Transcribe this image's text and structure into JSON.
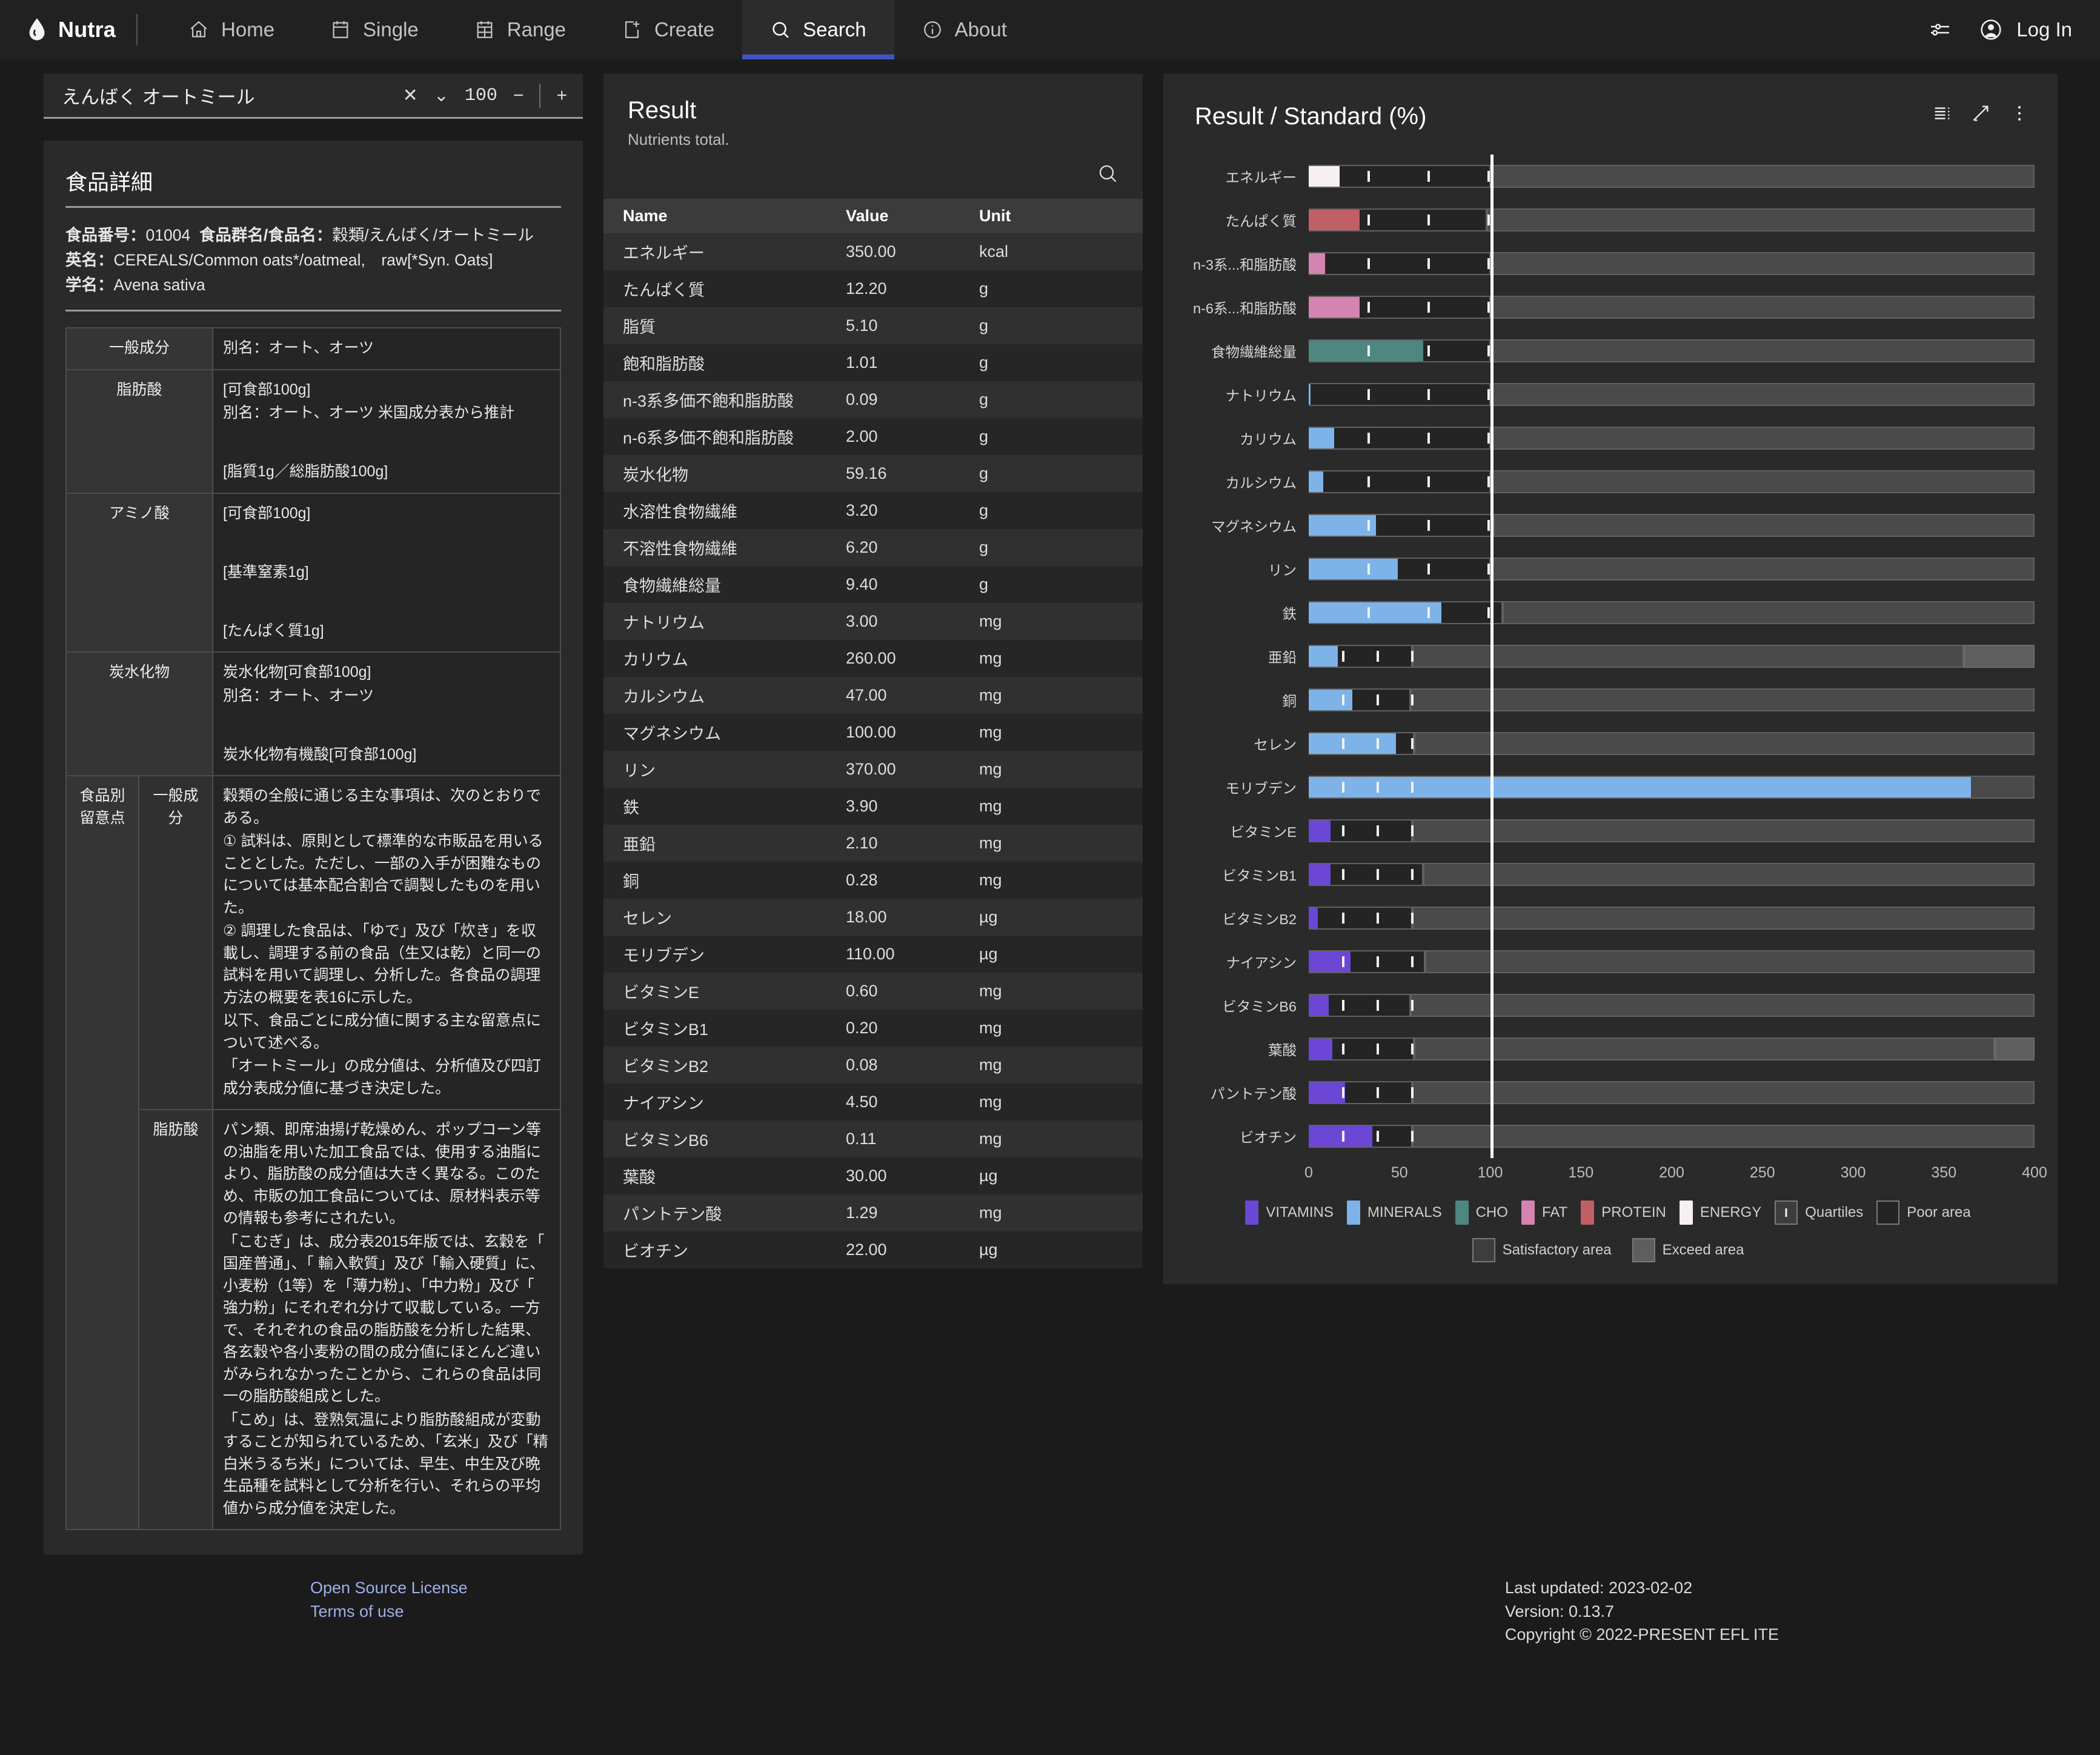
{
  "nav": {
    "brand": "Nutra",
    "items": [
      {
        "label": "Home",
        "icon": "home-icon",
        "active": false
      },
      {
        "label": "Single",
        "icon": "calendar-day-icon",
        "active": false
      },
      {
        "label": "Range",
        "icon": "calendar-range-icon",
        "active": false
      },
      {
        "label": "Create",
        "icon": "file-plus-icon",
        "active": false
      },
      {
        "label": "Search",
        "icon": "search-icon",
        "active": true
      },
      {
        "label": "About",
        "icon": "info-icon",
        "active": false
      }
    ],
    "settings_icon": "sliders-icon",
    "account_icon": "account-circle-icon",
    "login_label": "Log In",
    "accent": "#4055c4"
  },
  "search": {
    "query": "えんばく オートミール",
    "clear_label": "✕",
    "chevron_label": "⌄",
    "quantity": "100",
    "minus_label": "−",
    "plus_label": "+"
  },
  "detail": {
    "title": "食品詳細",
    "food_no_label": "食品番号：",
    "food_no": "01004",
    "group_label": "食品群名/食品名：",
    "group_value": "穀類/えんばく/オートミール",
    "en_label": "英名：",
    "en_value": "CEREALS/Common oats*/oatmeal,　raw[*Syn. Oats]",
    "sci_label": "学名：",
    "sci_value": "Avena sativa",
    "rows": [
      {
        "key": "一般成分",
        "key2": null,
        "lines": [
          "別名：オート、オーツ"
        ]
      },
      {
        "key": "脂肪酸",
        "key2": null,
        "lines": [
          "[可食部100g]",
          "別名：オート、オーツ 米国成分表から推計",
          "",
          "[脂質1g／総脂肪酸100g]"
        ]
      },
      {
        "key": "アミノ酸",
        "key2": null,
        "lines": [
          "[可食部100g]",
          "",
          "[基準窒素1g]",
          "",
          "[たんぱく質1g]"
        ]
      },
      {
        "key": "炭水化物",
        "key2": null,
        "lines": [
          "炭水化物[可食部100g]",
          "別名：オート、オーツ",
          "",
          "炭水化物有機酸[可食部100g]"
        ]
      },
      {
        "key": "食品別留意点",
        "key2": "一般成分",
        "lines": [
          "穀類の全般に通じる主な事項は、次のとおりである。",
          "① 試料は、原則として標準的な市販品を用いることとした。ただし、一部の入手が困難なものについては基本配合割合で調製したものを用いた。",
          "② 調理した食品は、「ゆで」及び「炊き」を収載し、調理する前の食品（生又は乾）と同一の試料を用いて調理し、分析した。各食品の調理方法の概要を表16に示した。",
          "以下、食品ごとに成分値に関する主な留意点について述べる。",
          "「オートミール」の成分値は、分析値及び四訂成分表成分値に基づき決定した。"
        ]
      },
      {
        "key": null,
        "key2": "脂肪酸",
        "lines": [
          "パン類、即席油揚げ乾燥めん、ポップコーン等の油脂を用いた加工食品では、使用する油脂により、脂肪酸の成分値は大きく異なる。このため、市販の加工食品については、原材料表示等の情報も参考にされたい。",
          "「こむぎ」は、成分表2015年版では、玄穀を「 国産普通」、「 輸入軟質」及び「輸入硬質」に、小麦粉（1等）を「薄力粉」、「中力粉」及び「 強力粉」にそれぞれ分けて収載している。一方で、それぞれの食品の脂肪酸を分析した結果、各玄穀や各小麦粉の間の成分値にほとんど違いがみられなかったことから、これらの食品は同一の脂肪酸組成とした。",
          "「こめ」は、登熟気温により脂肪酸組成が変動することが知られているため、「玄米」及び「精白米うるち米」については、早生、中生及び晩生品種を試料として分析を行い、それらの平均値から成分値を決定した。"
        ]
      }
    ]
  },
  "result": {
    "title": "Result",
    "subtitle": "Nutrients total.",
    "search_icon": "search-icon",
    "columns": [
      "Name",
      "Value",
      "Unit"
    ],
    "rows": [
      {
        "name": "エネルギー",
        "value": "350.00",
        "unit": "kcal"
      },
      {
        "name": "たんぱく質",
        "value": "12.20",
        "unit": "g"
      },
      {
        "name": "脂質",
        "value": "5.10",
        "unit": "g"
      },
      {
        "name": "飽和脂肪酸",
        "value": "1.01",
        "unit": "g"
      },
      {
        "name": "n-3系多価不飽和脂肪酸",
        "value": "0.09",
        "unit": "g"
      },
      {
        "name": "n-6系多価不飽和脂肪酸",
        "value": "2.00",
        "unit": "g"
      },
      {
        "name": "炭水化物",
        "value": "59.16",
        "unit": "g"
      },
      {
        "name": "水溶性食物繊維",
        "value": "3.20",
        "unit": "g"
      },
      {
        "name": "不溶性食物繊維",
        "value": "6.20",
        "unit": "g"
      },
      {
        "name": "食物繊維総量",
        "value": "9.40",
        "unit": "g"
      },
      {
        "name": "ナトリウム",
        "value": "3.00",
        "unit": "mg"
      },
      {
        "name": "カリウム",
        "value": "260.00",
        "unit": "mg"
      },
      {
        "name": "カルシウム",
        "value": "47.00",
        "unit": "mg"
      },
      {
        "name": "マグネシウム",
        "value": "100.00",
        "unit": "mg"
      },
      {
        "name": "リン",
        "value": "370.00",
        "unit": "mg"
      },
      {
        "name": "鉄",
        "value": "3.90",
        "unit": "mg"
      },
      {
        "name": "亜鉛",
        "value": "2.10",
        "unit": "mg"
      },
      {
        "name": "銅",
        "value": "0.28",
        "unit": "mg"
      },
      {
        "name": "セレン",
        "value": "18.00",
        "unit": "µg"
      },
      {
        "name": "モリブデン",
        "value": "110.00",
        "unit": "µg"
      },
      {
        "name": "ビタミンE",
        "value": "0.60",
        "unit": "mg"
      },
      {
        "name": "ビタミンB1",
        "value": "0.20",
        "unit": "mg"
      },
      {
        "name": "ビタミンB2",
        "value": "0.08",
        "unit": "mg"
      },
      {
        "name": "ナイアシン",
        "value": "4.50",
        "unit": "mg"
      },
      {
        "name": "ビタミンB6",
        "value": "0.11",
        "unit": "mg"
      },
      {
        "name": "葉酸",
        "value": "30.00",
        "unit": "µg"
      },
      {
        "name": "パントテン酸",
        "value": "1.29",
        "unit": "mg"
      },
      {
        "name": "ビオチン",
        "value": "22.00",
        "unit": "µg"
      }
    ]
  },
  "chart_panel": {
    "title": "Result / Standard (%)",
    "tools": [
      {
        "icon": "list-view-icon"
      },
      {
        "icon": "expand-icon"
      },
      {
        "icon": "more-vertical-icon"
      }
    ]
  },
  "chart_data": {
    "type": "bar",
    "orientation": "horizontal",
    "title": "Result / Standard (%)",
    "xlabel": "",
    "ylabel": "",
    "xlim": [
      0,
      400
    ],
    "xticks": [
      0,
      50,
      100,
      150,
      200,
      250,
      300,
      350,
      400
    ],
    "grid": false,
    "rdi_line": 100,
    "legend_position": "bottom",
    "colors": {
      "VITAMINS": "#6c47d6",
      "MINERALS": "#7db3e8",
      "CHO": "#4e8781",
      "FAT": "#d583b0",
      "PROTEIN": "#c05f65",
      "ENERGY": "#f7f0f0",
      "quartile_tick": "#f2f2f2",
      "poor_area": "#242424",
      "satisfactory_area": "#4a4a4a",
      "exceed_area": "#5e5e5e"
    },
    "categories": [
      "エネルギー",
      "たんぱく質",
      "n-3系...和脂肪酸",
      "n-6系...和脂肪酸",
      "食物繊維総量",
      "ナトリウム",
      "カリウム",
      "カルシウム",
      "マグネシウム",
      "リン",
      "鉄",
      "亜鉛",
      "銅",
      "セレン",
      "モリブデン",
      "ビタミンE",
      "ビタミンB1",
      "ビタミンB2",
      "ナイアシン",
      "ビタミンB6",
      "葉酸",
      "パントテン酸",
      "ビオチン"
    ],
    "series": [
      {
        "name": "Result / Standard (%)",
        "values": [
          17,
          28,
          9,
          28,
          63,
          1,
          14,
          8,
          37,
          49,
          73,
          16,
          24,
          48,
          365,
          12,
          12,
          5,
          23,
          11,
          13,
          20,
          35
        ]
      }
    ],
    "group_of_category": [
      "ENERGY",
      "PROTEIN",
      "FAT",
      "FAT",
      "CHO",
      "MINERALS",
      "MINERALS",
      "MINERALS",
      "MINERALS",
      "MINERALS",
      "MINERALS",
      "MINERALS",
      "MINERALS",
      "MINERALS",
      "MINERALS",
      "VITAMINS",
      "VITAMINS",
      "VITAMINS",
      "VITAMINS",
      "VITAMINS",
      "VITAMINS",
      "VITAMINS",
      "VITAMINS"
    ],
    "poor_end": [
      100,
      98,
      100,
      100,
      100,
      100,
      100,
      100,
      102,
      100,
      107,
      57,
      56,
      58,
      52,
      57,
      63,
      57,
      64,
      56,
      58,
      57,
      57
    ],
    "satisfactory_end": [
      400,
      400,
      400,
      400,
      400,
      400,
      400,
      400,
      400,
      400,
      400,
      361,
      400,
      400,
      400,
      400,
      400,
      400,
      400,
      400,
      378,
      400,
      400
    ],
    "exceed_end": [
      400,
      400,
      400,
      400,
      400,
      400,
      400,
      400,
      400,
      400,
      400,
      400,
      400,
      400,
      400,
      400,
      400,
      400,
      400,
      400,
      400,
      400,
      400
    ],
    "quartiles": [
      [
        33,
        66,
        99
      ],
      [
        33,
        66,
        99
      ],
      [
        33,
        66,
        99
      ],
      [
        33,
        66,
        99
      ],
      [
        33,
        66,
        99
      ],
      [
        33,
        66,
        99
      ],
      [
        33,
        66,
        99
      ],
      [
        33,
        66,
        99
      ],
      [
        33,
        66,
        99
      ],
      [
        33,
        66,
        99
      ],
      [
        33,
        66,
        99
      ],
      [
        19,
        38,
        57
      ],
      [
        19,
        38,
        57
      ],
      [
        19,
        38,
        57
      ],
      [
        19,
        38,
        57
      ],
      [
        19,
        38,
        57
      ],
      [
        19,
        38,
        57
      ],
      [
        19,
        38,
        57
      ],
      [
        19,
        38,
        57
      ],
      [
        19,
        38,
        57
      ],
      [
        19,
        38,
        57
      ],
      [
        19,
        38,
        57
      ],
      [
        19,
        38,
        57
      ]
    ],
    "legend": [
      {
        "label": "VITAMINS",
        "color": "#6c47d6",
        "shape": "swatch"
      },
      {
        "label": "MINERALS",
        "color": "#7db3e8",
        "shape": "swatch"
      },
      {
        "label": "CHO",
        "color": "#4e8781",
        "shape": "swatch"
      },
      {
        "label": "FAT",
        "color": "#d583b0",
        "shape": "swatch"
      },
      {
        "label": "PROTEIN",
        "color": "#c05f65",
        "shape": "swatch"
      },
      {
        "label": "ENERGY",
        "color": "#f7f0f0",
        "shape": "swatch"
      },
      {
        "label": "Quartiles",
        "color": "#3d3d3d",
        "shape": "tickbox"
      },
      {
        "label": "Poor area",
        "color": "#242424",
        "shape": "box"
      }
    ],
    "legend2": [
      {
        "label": "Satisfactory area",
        "color": "#3d3d3d",
        "shape": "box"
      },
      {
        "label": "Exceed area",
        "color": "#5e5e5e",
        "shape": "box"
      }
    ]
  },
  "footer": {
    "links": [
      "Open Source License",
      "Terms of use"
    ],
    "info": [
      "Last updated: 2023-02-02",
      "Version: 0.13.7",
      "Copyright © 2022-PRESENT EFL ITE"
    ]
  }
}
